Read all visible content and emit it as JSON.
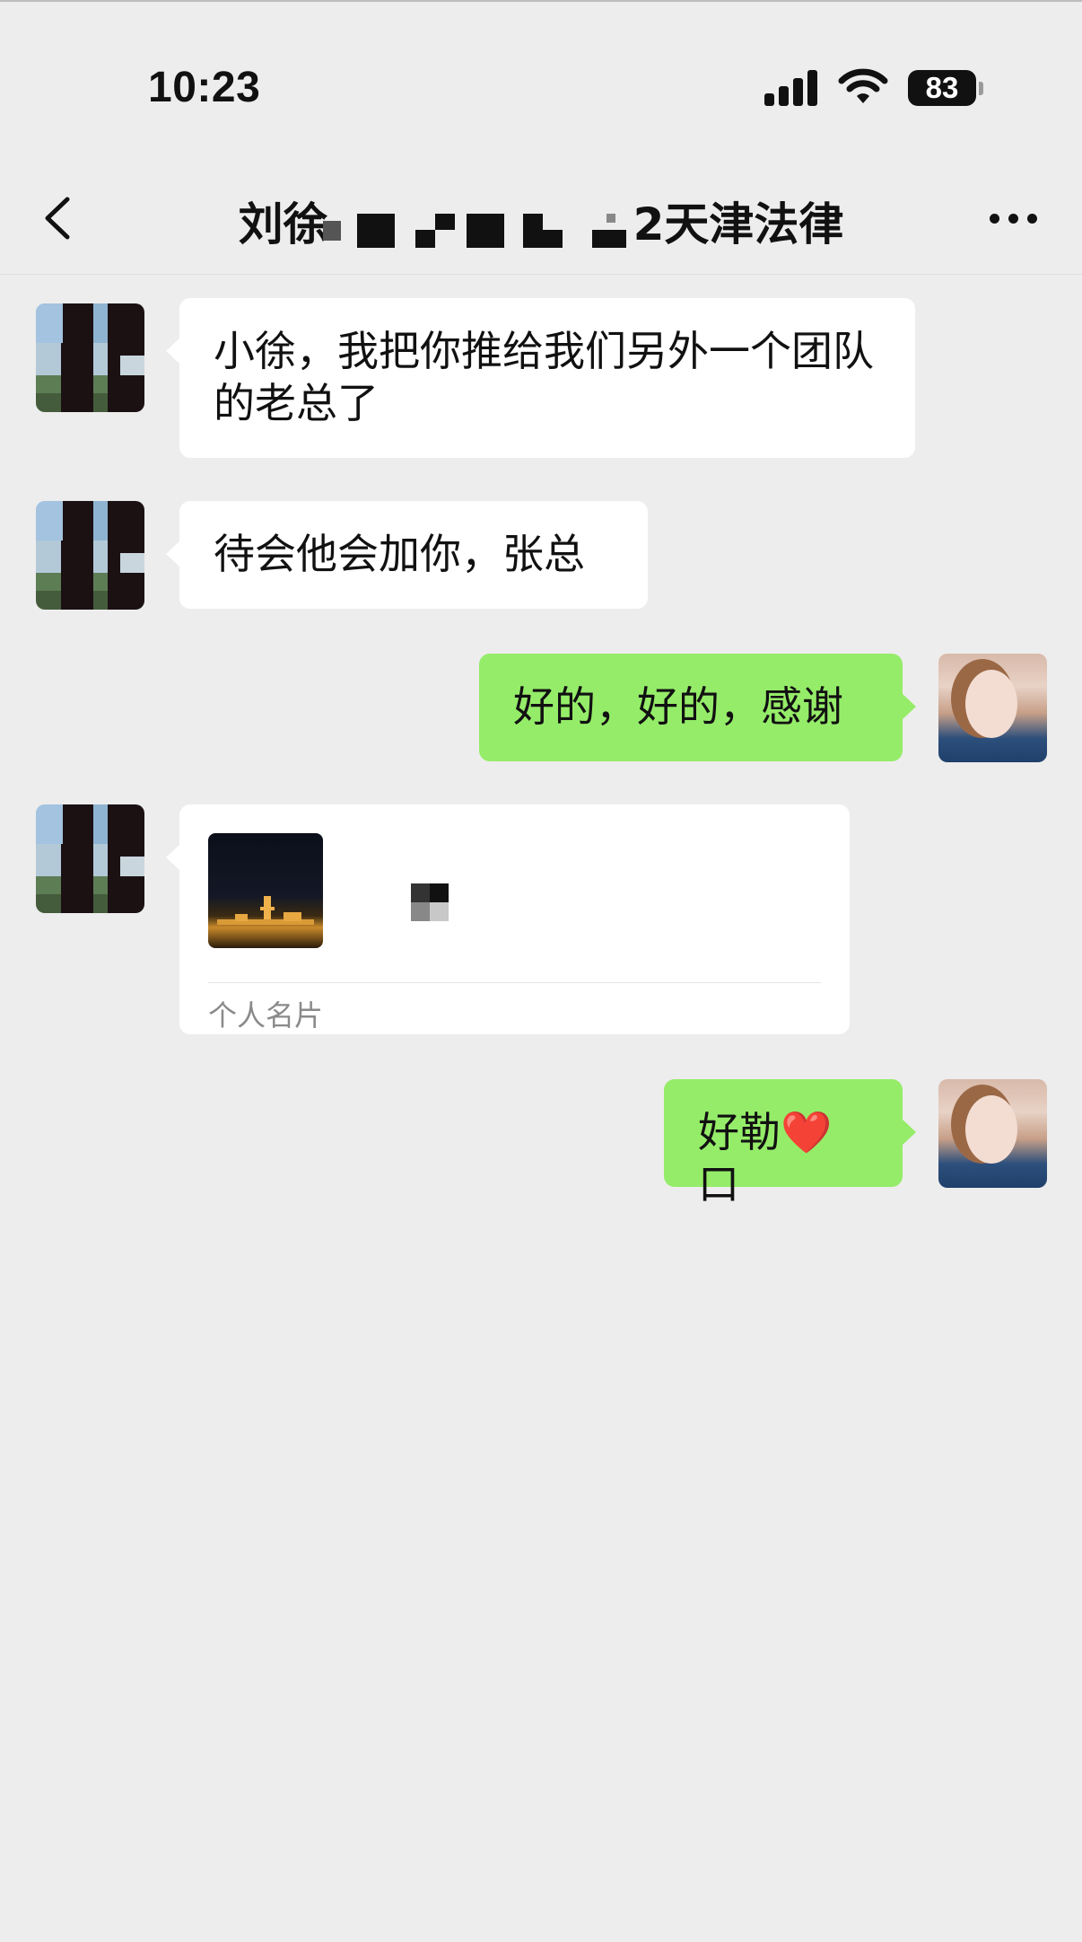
{
  "status_bar": {
    "time": "10:23",
    "battery": "83"
  },
  "nav": {
    "title_prefix": "刘徐",
    "title_suffix": "2天津法律"
  },
  "messages": [
    {
      "side": "in",
      "text": "小徐，我把你推给我们另外一个团队的老总了"
    },
    {
      "side": "in",
      "text": "待会他会加你，张总"
    },
    {
      "side": "out",
      "text": "好的，好的，感谢"
    },
    {
      "side": "in",
      "type": "card",
      "label": "个人名片"
    },
    {
      "side": "out",
      "text_before": "好勒",
      "emoji": "❤️",
      "text_after": "口"
    }
  ],
  "colors": {
    "background": "#ededed",
    "incoming_bubble": "#ffffff",
    "outgoing_bubble": "#95ec69"
  },
  "icons": [
    "back-chevron-icon",
    "more-dots-icon",
    "signal-icon",
    "wifi-icon",
    "battery-icon"
  ]
}
